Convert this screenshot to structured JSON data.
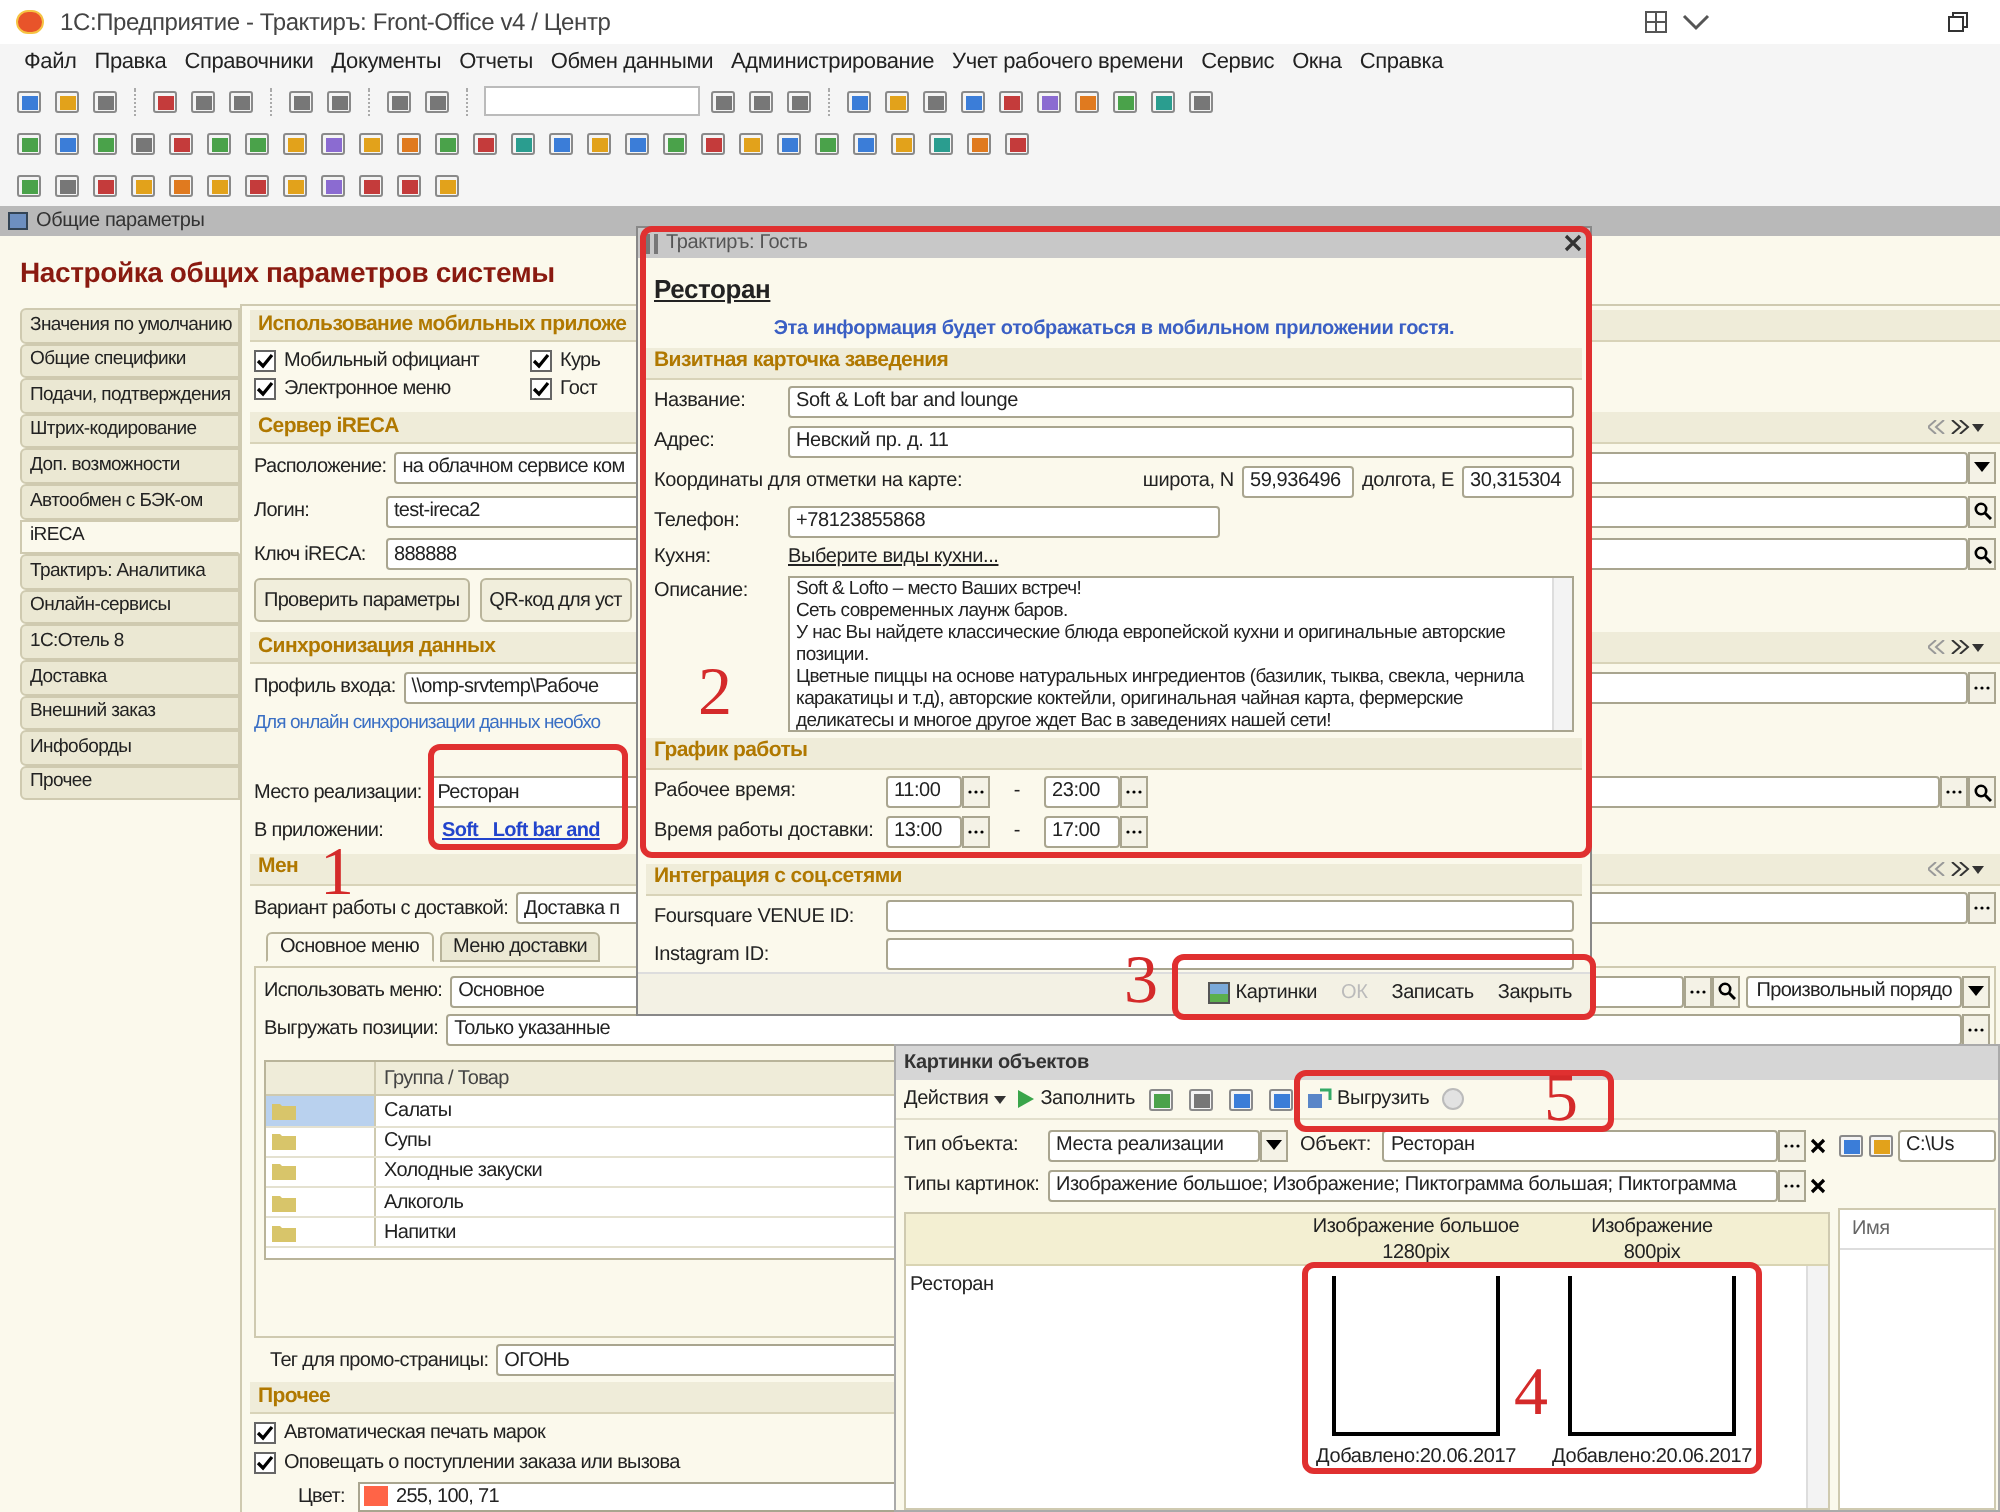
{
  "app_title": "1С:Предприятие - Трактиръ: Front-Office v4 / Центр",
  "menu": [
    "Файл",
    "Правка",
    "Справочники",
    "Документы",
    "Отчеты",
    "Обмен данными",
    "Администрирование",
    "Учет рабочего времени",
    "Сервис",
    "Окна",
    "Справка"
  ],
  "form": {
    "title": "Общие параметры",
    "heading": "Настройка общих параметров системы",
    "tabs": [
      {
        "label": "Значения по умолчанию",
        "selected": false
      },
      {
        "label": "Общие специфики",
        "selected": false
      },
      {
        "label": "Подачи, подтверждения",
        "selected": false
      },
      {
        "label": "Штрих-кодирование",
        "selected": false
      },
      {
        "label": "Доп. возможности",
        "selected": false
      },
      {
        "label": "Автообмен с БЭК-ом",
        "selected": false
      },
      {
        "label": "iRECA",
        "selected": true
      },
      {
        "label": "Трактиръ: Аналитика",
        "selected": false
      },
      {
        "label": "Онлайн-сервисы",
        "selected": false
      },
      {
        "label": "1С:Отель 8",
        "selected": false
      },
      {
        "label": "Доставка",
        "selected": false
      },
      {
        "label": "Внешний заказ",
        "selected": false
      },
      {
        "label": "Инфоборды",
        "selected": false
      },
      {
        "label": "Прочее",
        "selected": false
      }
    ],
    "mobile": {
      "title": "Использование мобильных приложе",
      "checks": [
        {
          "label": "Мобильный официант",
          "checked": true
        },
        {
          "label": "Курь",
          "checked": true
        },
        {
          "label": "Электронное меню",
          "checked": true
        },
        {
          "label": "Гост",
          "checked": true
        }
      ]
    },
    "server": {
      "title": "Сервер iRECA",
      "fields": [
        {
          "label": "Расположение:",
          "value": "на облачном сервисе ком",
          "kind": "dropdown"
        },
        {
          "label": "Логин:",
          "value": "test-ireca2",
          "kind": "search"
        },
        {
          "label": "Ключ iRECA:",
          "value": "888888",
          "kind": "search"
        }
      ],
      "buttons": [
        "Проверить параметры",
        "QR-код для уст"
      ]
    },
    "sync": {
      "title": "Синхронизация данных",
      "fields": [
        {
          "label": "Профиль входа:",
          "value": "\\\\omp-srvtemp\\Рабоче",
          "kind": "choice"
        }
      ],
      "link": "Для онлайн синхронизации данных необхо"
    },
    "place": {
      "label": "Место реализации:",
      "value": "Ресторан",
      "kind": "choice-search"
    },
    "app_link": {
      "label": "В приложении:",
      "value": "Soft   Loft bar and"
    },
    "menu_section": {
      "title": "Мен",
      "delivery": {
        "label": "Вариант работы с доставкой:",
        "value": "Доставка п"
      },
      "tabs": [
        {
          "label": "Основное меню",
          "selected": true
        },
        {
          "label": "Меню доставки",
          "selected": false
        }
      ],
      "fields": [
        {
          "label": "Использовать меню:",
          "value": "Основное"
        },
        {
          "label": "Выгружать позиции:",
          "value": "Только указанные"
        }
      ],
      "order": "Произвольный порядо",
      "table": {
        "column": "Группа / Товар",
        "rows": [
          {
            "name": "Салаты",
            "selected": true
          },
          {
            "name": "Супы",
            "selected": false
          },
          {
            "name": "Холодные закуски",
            "selected": false
          },
          {
            "name": "Алкоголь",
            "selected": false
          },
          {
            "name": "Напитки",
            "selected": false
          }
        ]
      }
    },
    "promo": {
      "label": "Тег для промо-страницы:",
      "value": "ОГОНЬ"
    },
    "other": {
      "title": "Прочее",
      "checks": [
        {
          "label": "Автоматическая печать марок",
          "checked": true
        },
        {
          "label": "Оповещать о поступлении заказа или вызова",
          "checked": true
        }
      ],
      "color_field": {
        "label": "Цвет:",
        "value": "255, 100, 71",
        "color": "#ff6447"
      }
    }
  },
  "dialog": {
    "title": "Трактиръ: Гость",
    "heading": "Ресторан",
    "note": "Эта информация будет отображаться в мобильном приложении гостя.",
    "card_title": "Визитная карточка заведения",
    "name": {
      "label": "Название:",
      "value": "Soft & Loft bar and lounge"
    },
    "address": {
      "label": "Адрес:",
      "value": "Невский пр. д. 11"
    },
    "coords": {
      "label": "Координаты для отметки на карте:",
      "lat_label": "широта, N",
      "lat": "59,936496",
      "lon_label": "долгота, E",
      "lon": "30,315304"
    },
    "phone": {
      "label": "Телефон:",
      "value": "+78123855868"
    },
    "cuisine": {
      "label": "Кухня:",
      "link": "Выберите виды кухни..."
    },
    "description": {
      "label": "Описание:",
      "lines": [
        "Soft & Lofto – место Ваших встреч!",
        "Сеть современных лаунж баров.",
        "У нас Вы найдете классические блюда европейской кухни и оригинальные авторские позиции.",
        "Цветные пиццы на основе натуральных ингредиентов (базилик, тыква, свекла, чернила каракатицы и т.д), авторские коктейли, оригинальная чайная карта, фермерские деликатесы и многое другое ждет Вас в заведениях нашей сети!"
      ]
    },
    "schedule_title": "График работы",
    "schedule": [
      {
        "label": "Рабочее время:",
        "from": "11:00",
        "separator": "-",
        "to": "23:00"
      },
      {
        "label": "Время работы доставки:",
        "from": "13:00",
        "separator": "-",
        "to": "17:00"
      }
    ],
    "social_title": "Интеграция с соц.сетями",
    "social": [
      {
        "label": "Foursquare VENUE ID:"
      },
      {
        "label": "Instagram ID:"
      }
    ],
    "buttons": [
      {
        "label": "Картинки",
        "disabled": false
      },
      {
        "label": "ОК",
        "disabled": true
      },
      {
        "label": "Записать",
        "disabled": false
      },
      {
        "label": "Закрыть",
        "disabled": false
      }
    ]
  },
  "pictures": {
    "title": "Картинки объектов",
    "actions": "Действия",
    "fill": "Заполнить",
    "export": "Выгрузить",
    "object_type": {
      "label": "Тип объекта:",
      "value": "Места реализации"
    },
    "object": {
      "label": "Объект:",
      "value": "Ресторан"
    },
    "types": {
      "label": "Типы картинок:",
      "value": "Изображение большое; Изображение; Пиктограмма большая; Пиктограмма"
    },
    "path": "C:\\Us",
    "name_column": "Имя",
    "columns": [
      {
        "title": "Изображение большое",
        "size": "1280pix"
      },
      {
        "title": "Изображение",
        "size": "800pix"
      }
    ],
    "row": "Ресторан",
    "images": [
      {
        "caption": "Добавлено:20.06.2017"
      },
      {
        "caption": "Добавлено:20.06.2017"
      }
    ]
  },
  "annotations": [
    "1",
    "2",
    "3",
    "4",
    "5"
  ]
}
